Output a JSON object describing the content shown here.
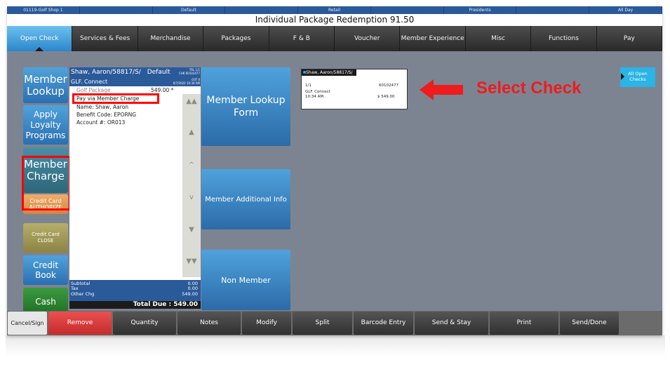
{
  "top_info": [
    "01119-Golf Shop 1",
    "",
    "Default",
    "",
    "Retail",
    "",
    "Presidents",
    "",
    "All Day"
  ],
  "title": "Individual Package Redemption 91.50",
  "tabs": [
    "Open Check",
    "Services & Fees",
    "Merchandise",
    "Packages",
    "F & B",
    "Voucher",
    "Member Experience",
    "Misc",
    "Functions",
    "Pay"
  ],
  "left_buttons": {
    "member_lookup": "Member Lookup",
    "apply_loyalty": "Apply Loyalty Programs",
    "member_charge": "Member Charge",
    "cc_authorize_1": "Credit Card",
    "cc_authorize_2": "AUTHORIZE",
    "cc_close_1": "Credit Card",
    "cc_close_2": "CLOSE",
    "credit_book": "Credit Book",
    "cash": "Cash",
    "cancel_sign_out": "Cancel/Sign Out"
  },
  "check": {
    "header_name": "Shaw, Aaron/58817/S/",
    "header_default": "Default",
    "trl": "TRL 1/1",
    "chk": "CHK 60102477",
    "gst": "GST 0",
    "datetime": "6/7/2022 10:34 AM",
    "section": "GLF. Connect",
    "item_name": "Golf Package",
    "item_price": "549.00 *",
    "pay_via": "Pay via Member Charge",
    "name_line": "Name: Shaw, Aaron",
    "benefit_line": "Benefit Code: EPORNG",
    "account_line": "Account #: OR013",
    "subtotal_label": "Subtotal",
    "subtotal_value": "0.00",
    "tax_label": "Tax",
    "tax_value": "0.00",
    "other_label": "Other Chg",
    "other_value": "549.00",
    "total_due": "Total Due :  549.00"
  },
  "middle_buttons": {
    "member_lookup_form": "Member Lookup Form",
    "member_additional_info": "Member Additional Info",
    "non_member": "Non Member"
  },
  "open_check_card": {
    "header": "Shaw, Aaron/58817/S/",
    "seq": "1/1",
    "check_no": "60102477",
    "type": "GLF. Connect",
    "time": "10:34 AM",
    "amount": "$ 549.00"
  },
  "annotation": "Select Check",
  "all_open_checks": "All Open Checks",
  "bottom_buttons": [
    "Remove",
    "Quantity",
    "Notes",
    "Modify",
    "Split",
    "Barcode Entry",
    "Send & Stay",
    "Print",
    "Send/Done"
  ],
  "colors": {
    "header_blue": "#2b5a9a",
    "active_tab": "#3f9fe0",
    "annotation_red": "#ee1c1c",
    "remove_red": "#e03a3a"
  }
}
